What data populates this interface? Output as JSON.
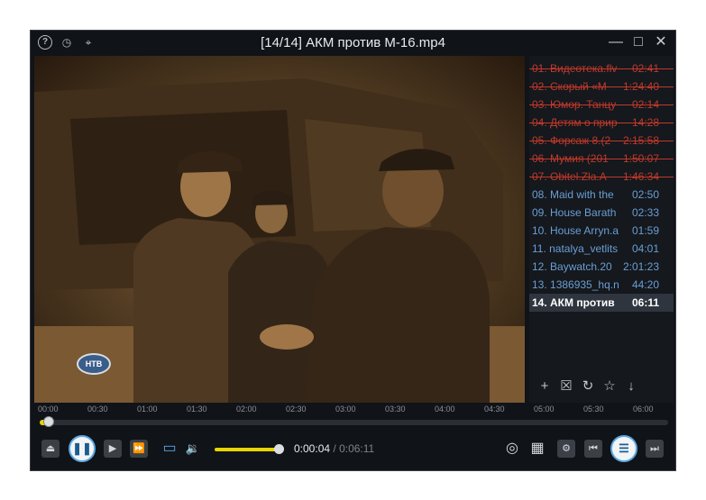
{
  "window": {
    "title": "[14/14] АКМ против М-16.mp4",
    "help_icon": "?",
    "history_icon": "◷",
    "pin_icon": "⌖",
    "minimize_icon": "—",
    "maximize_icon": "□",
    "close_icon": "✕"
  },
  "playlist": {
    "items": [
      {
        "label": "01. Видеотека.flv",
        "duration": "02:41",
        "state": "removed"
      },
      {
        "label": "02. Скорый «М",
        "duration": "1:24:40",
        "state": "removed"
      },
      {
        "label": "03. Юмор. Танцу",
        "duration": "02:14",
        "state": "removed"
      },
      {
        "label": "04. Детям о прир",
        "duration": "14:28",
        "state": "removed"
      },
      {
        "label": "05. Форсаж 8.(2",
        "duration": "2:15:58",
        "state": "removed"
      },
      {
        "label": "06. Мумия (201",
        "duration": "1:50:07",
        "state": "removed"
      },
      {
        "label": "07. Obitel.Zla.A",
        "duration": "1:46:34",
        "state": "removed"
      },
      {
        "label": "08. Maid with the",
        "duration": "02:50",
        "state": "normal"
      },
      {
        "label": "09. House Barath",
        "duration": "02:33",
        "state": "normal"
      },
      {
        "label": "10. House Arryn.a",
        "duration": "01:59",
        "state": "normal"
      },
      {
        "label": "11. natalya_vetlits",
        "duration": "04:01",
        "state": "normal"
      },
      {
        "label": "12. Baywatch.20",
        "duration": "2:01:23",
        "state": "normal"
      },
      {
        "label": "13. 1386935_hq.n",
        "duration": "44:20",
        "state": "normal"
      },
      {
        "label": "14. АКМ против",
        "duration": "06:11",
        "state": "current"
      }
    ],
    "tools": [
      "+",
      "☒",
      "↻",
      "☆",
      "↓"
    ]
  },
  "video": {
    "channel_logo": "НТВ"
  },
  "timeline": {
    "ticks": [
      "00:00",
      "00:30",
      "01:00",
      "01:30",
      "02:00",
      "02:30",
      "03:00",
      "03:30",
      "04:00",
      "04:30",
      "05:00",
      "05:30",
      "06:00"
    ],
    "progress": 0.011
  },
  "controls": {
    "eject": "⏏",
    "pause": "❚❚",
    "next_frame": "▶",
    "fast_forward": "⏩",
    "subtitles": "▭",
    "volume_icon": "🔉",
    "volume_level": 1.0,
    "current_time": "0:00:04",
    "separator": "/",
    "total_time": "0:06:11",
    "screenshot": "◎",
    "film": "▦",
    "settings": "⚙",
    "prev": "⏮",
    "playlist_toggle": "☰",
    "next": "⏭"
  },
  "colors": {
    "removed": "#c0392b",
    "normal": "#6a9fd4",
    "current": "#ffffff",
    "current_bg": "#2e353e",
    "accent": "#e8d400",
    "time_current": "#e8eaec",
    "time_total": "#7d838a"
  }
}
